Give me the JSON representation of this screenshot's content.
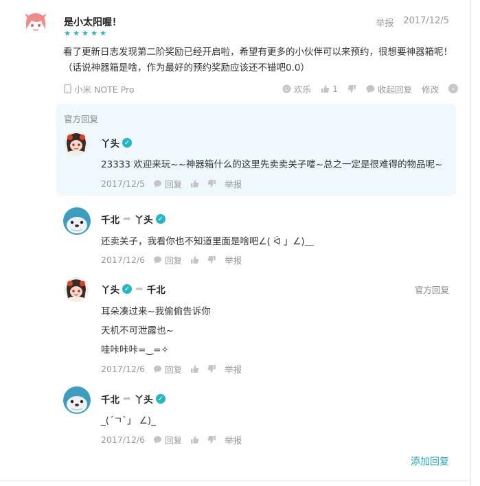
{
  "review": {
    "author": "是小太阳喔！",
    "stars": 5,
    "report_label": "举报",
    "date": "2017/12/5",
    "text": "看了更新日志发现第二阶奖励已经开启啦，希望有更多的小伙伴可以来预约，很想要神器箱呢！（话说神器箱是啥，作为最好的预约奖励应该还不错吧0.0）",
    "device": "小米 NOTE Pro",
    "fun_label": "欢乐",
    "like_count": "1",
    "collapse_label": "收起回复",
    "edit_label": "修改"
  },
  "official": {
    "label": "官方回复",
    "name": "丫头",
    "text": "23333 欢迎来玩~~神器箱什么的这里先卖卖关子喽~总之一定是很难得的物品呢~",
    "date": "2017/12/5",
    "reply_label": "回复",
    "report_label": "举报"
  },
  "replies": [
    {
      "from": "千北",
      "to": "丫头",
      "text": "还卖关子，我看你也不知道里面是啥吧∠( ᐛ 」∠)＿",
      "date": "2017/12/6",
      "reply_label": "回复",
      "report_label": "举报"
    },
    {
      "from": "丫头",
      "to": "千北",
      "tag": "官方回复",
      "lines": [
        "耳朵凑过来~我偷偷告诉你",
        "天机不可泄露也~",
        "哇咔咔咔=‿=✧"
      ],
      "date": "2017/12/6",
      "reply_label": "回复",
      "report_label": "举报"
    },
    {
      "from": "千北",
      "to": "丫头",
      "text": "_(´ㄱ`」 ∠)_",
      "date": "2017/12/6",
      "reply_label": "回复",
      "report_label": "举报"
    }
  ],
  "add_reply_label": "添加回复",
  "colors": {
    "accent": "#24b5c9",
    "link": "#24a8bf",
    "official_bg": "#eef8fd",
    "muted": "#999999"
  },
  "icons": [
    "phone-icon",
    "smile-icon",
    "thumb-up-icon",
    "thumb-down-icon",
    "comment-icon",
    "chevron-down-icon",
    "verified-icon",
    "reply-arrow-icon"
  ]
}
